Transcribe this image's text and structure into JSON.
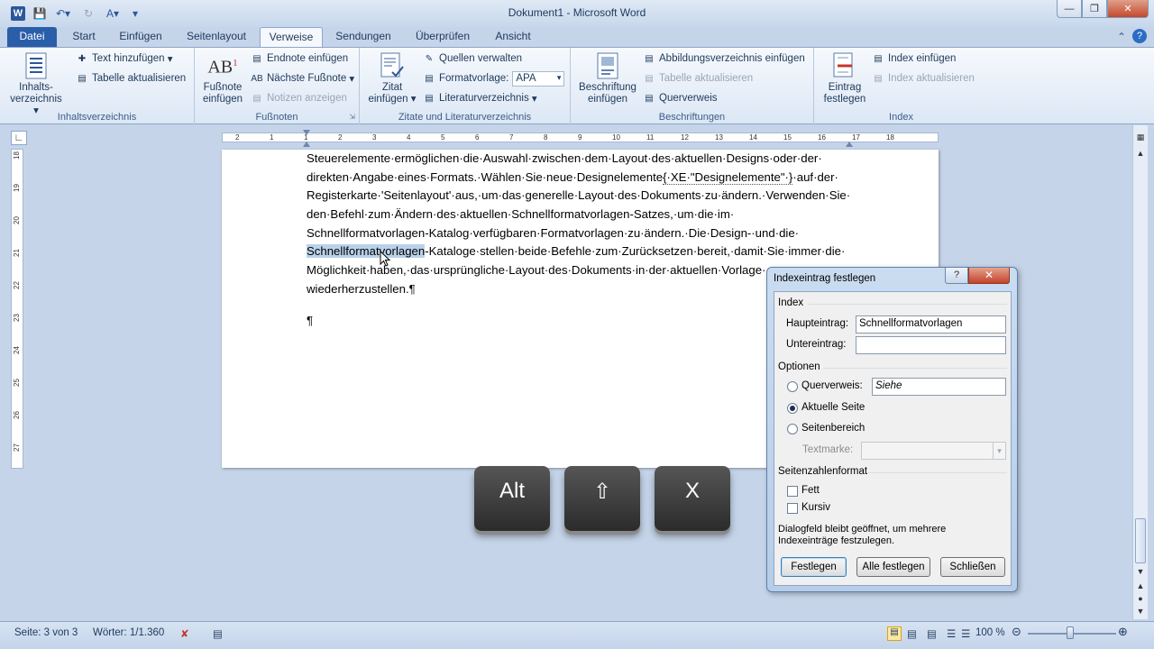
{
  "window": {
    "title": "Dokument1 - Microsoft Word"
  },
  "tabs": [
    "Datei",
    "Start",
    "Einfügen",
    "Seitenlayout",
    "Verweise",
    "Sendungen",
    "Überprüfen",
    "Ansicht"
  ],
  "active_tab": "Verweise",
  "ribbon": {
    "toc": {
      "big_label_1": "Inhalts-",
      "big_label_2": "verzeichnis",
      "add_text": "Text hinzufügen",
      "update_table": "Tabelle aktualisieren",
      "group": "Inhaltsverzeichnis"
    },
    "footnotes": {
      "big_label_1": "Fußnote",
      "big_label_2": "einfügen",
      "insert_endnote": "Endnote einfügen",
      "next_footnote": "Nächste Fußnote",
      "show_notes": "Notizen anzeigen",
      "group": "Fußnoten"
    },
    "citations": {
      "big_label_1": "Zitat",
      "big_label_2": "einfügen",
      "manage_sources": "Quellen verwalten",
      "style_label": "Formatvorlage:",
      "style_value": "APA",
      "bibliography": "Literaturverzeichnis",
      "group": "Zitate und Literaturverzeichnis"
    },
    "captions": {
      "big_label_1": "Beschriftung",
      "big_label_2": "einfügen",
      "insert_figures": "Abbildungsverzeichnis einfügen",
      "update_table": "Tabelle aktualisieren",
      "cross_ref": "Querverweis",
      "group": "Beschriftungen"
    },
    "index": {
      "big_label_1": "Eintrag",
      "big_label_2": "festlegen",
      "insert_index": "Index einfügen",
      "update_index": "Index aktualisieren",
      "group": "Index"
    }
  },
  "ruler": {
    "h_ticks": [
      "2",
      "1",
      "1",
      "2",
      "3",
      "4",
      "5",
      "6",
      "7",
      "8",
      "9",
      "10",
      "11",
      "12",
      "13",
      "14",
      "15",
      "16",
      "17",
      "18"
    ],
    "v_ticks": [
      "18",
      "19",
      "20",
      "21",
      "22",
      "23",
      "24",
      "25",
      "26",
      "27"
    ]
  },
  "document": {
    "line1": "Steuerelemente·ermöglichen·die·Auswahl·zwischen·dem·Layout·des·aktuellen·Designs·oder·der·",
    "line2a": "direkten·Angabe·eines·Formats.·Wählen·Sie·neue·Designelemente",
    "line2b": "{·XE·\"Designelemente\"·}",
    "line2c": "·auf·der·",
    "line3": "Registerkarte·'Seitenlayout'·aus,·um·das·generelle·Layout·des·Dokuments·zu·ändern.·Verwenden·Sie·",
    "line4": "den·Befehl·zum·Ändern·des·aktuellen·Schnellformatvorlagen-Satzes,·um·die·im·",
    "line5": "Schnellformatvorlagen-Katalog·verfügbaren·Formatvorlagen·zu·ändern.·Die·Design-·und·die·",
    "line6_selected": "Schnellformatvorlagen",
    "line6_rest": "-Kataloge·stellen·beide·Befehle·zum·Zurücksetzen·bereit,·damit·Sie·immer·die·",
    "line7": "Möglichkeit·haben,·das·ursprüngliche·Layout·des·Dokuments·in·der·aktuellen·Vorlage·",
    "line8": "wiederherzustellen.¶",
    "line9": "¶"
  },
  "keys": [
    "Alt",
    "⇧",
    "X"
  ],
  "dialog": {
    "title": "Indexeintrag festlegen",
    "help": "?",
    "close": "✕",
    "section_index": "Index",
    "main_entry_label": "Haupteintrag:",
    "main_entry_value": "Schnellformatvorlagen",
    "sub_entry_label": "Untereintrag:",
    "sub_entry_value": "",
    "section_options": "Optionen",
    "cross_ref_label": "Querverweis:",
    "cross_ref_value": "Siehe",
    "current_page_label": "Aktuelle Seite",
    "page_range_label": "Seitenbereich",
    "bookmark_label": "Textmarke:",
    "section_format": "Seitenzahlenformat",
    "bold_label": "Fett",
    "italic_label": "Kursiv",
    "info_text_1": "Dialogfeld bleibt geöffnet, um mehrere",
    "info_text_2": "Indexeinträge festzulegen.",
    "btn_mark": "Festlegen",
    "btn_mark_all": "Alle festlegen",
    "btn_close": "Schließen"
  },
  "status": {
    "page": "Seite: 3 von 3",
    "words": "Wörter: 1/1.360",
    "zoom": "100 %"
  }
}
